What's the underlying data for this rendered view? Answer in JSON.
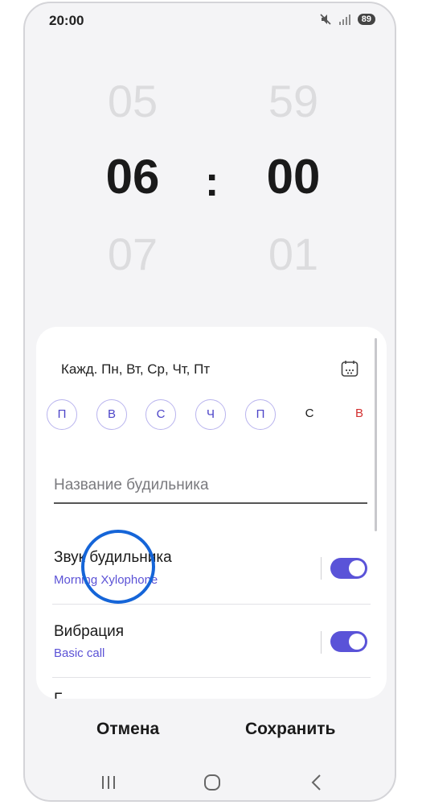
{
  "status": {
    "time": "20:00",
    "battery": "89"
  },
  "picker": {
    "hours": {
      "prev": "05",
      "selected": "06",
      "next": "07"
    },
    "separator": ":",
    "minutes": {
      "prev": "59",
      "selected": "00",
      "next": "01"
    }
  },
  "alarm": {
    "repeat_text": "Кажд. Пн, Вт, Ср, Чт, Пт",
    "days": [
      {
        "label": "П",
        "selected": true
      },
      {
        "label": "В",
        "selected": true
      },
      {
        "label": "С",
        "selected": true
      },
      {
        "label": "Ч",
        "selected": true
      },
      {
        "label": "П",
        "selected": true
      },
      {
        "label": "С",
        "selected": false
      },
      {
        "label": "В",
        "selected": false
      }
    ],
    "name_placeholder": "Название будильника",
    "sound": {
      "title": "Звук будильника",
      "value": "Morning Xylophone",
      "enabled": true
    },
    "vibration": {
      "title": "Вибрация",
      "value": "Basic call",
      "enabled": true
    },
    "next_row_partial": "Г"
  },
  "actions": {
    "cancel": "Отмена",
    "save": "Сохранить"
  },
  "colors": {
    "accent": "#5a53d8",
    "sunday": "#d32f2f",
    "highlight_ring": "#1565d8"
  }
}
